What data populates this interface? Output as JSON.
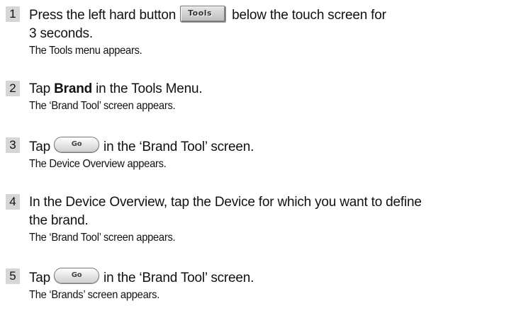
{
  "steps": [
    {
      "number": "1",
      "instruction_before": "Press the left hard button",
      "button_label": "Tools",
      "instruction_after_line1": "below the touch screen for",
      "instruction_line2": "3 seconds.",
      "result": "The Tools menu appears."
    },
    {
      "number": "2",
      "instruction_before": "Tap",
      "instruction_bold": "Brand",
      "instruction_after": "in the Tools Menu.",
      "result": "The ‘Brand Tool’ screen appears."
    },
    {
      "number": "3",
      "instruction_before": "Tap",
      "button_label": "Go",
      "instruction_after": "in the ‘Brand Tool’ screen.",
      "result": "The Device Overview appears."
    },
    {
      "number": "4",
      "instruction_line1": "In the Device Overview, tap the Device for which you want to define",
      "instruction_line2": "the brand.",
      "result": "The ‘Brand Tool’ screen appears."
    },
    {
      "number": "5",
      "instruction_before": "Tap",
      "button_label": "Go",
      "instruction_after": "in the ‘Brand Tool’ screen.",
      "result": "The ‘Brands’ screen appears."
    }
  ]
}
